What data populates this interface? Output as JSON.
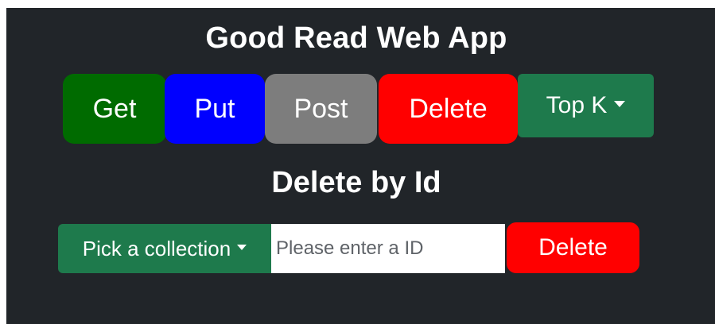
{
  "app": {
    "title": "Good Read Web App",
    "background_color": "#212529"
  },
  "toolbar": {
    "buttons": [
      {
        "label": "Get",
        "color": "#006b00"
      },
      {
        "label": "Put",
        "color": "#0000ff"
      },
      {
        "label": "Post",
        "color": "#7d7d7d"
      },
      {
        "label": "Delete",
        "color": "#ff0000"
      }
    ],
    "top_k": {
      "label": "Top K",
      "icon": "caret-down-icon",
      "color": "#1e7a4c"
    }
  },
  "delete_section": {
    "title": "Delete by Id",
    "collection_picker": {
      "label": "Pick a collection",
      "icon": "caret-down-icon",
      "color": "#1e7a4c"
    },
    "id_input": {
      "value": "",
      "placeholder": "Please enter a ID"
    },
    "submit": {
      "label": "Delete",
      "color": "#ff0000"
    }
  }
}
